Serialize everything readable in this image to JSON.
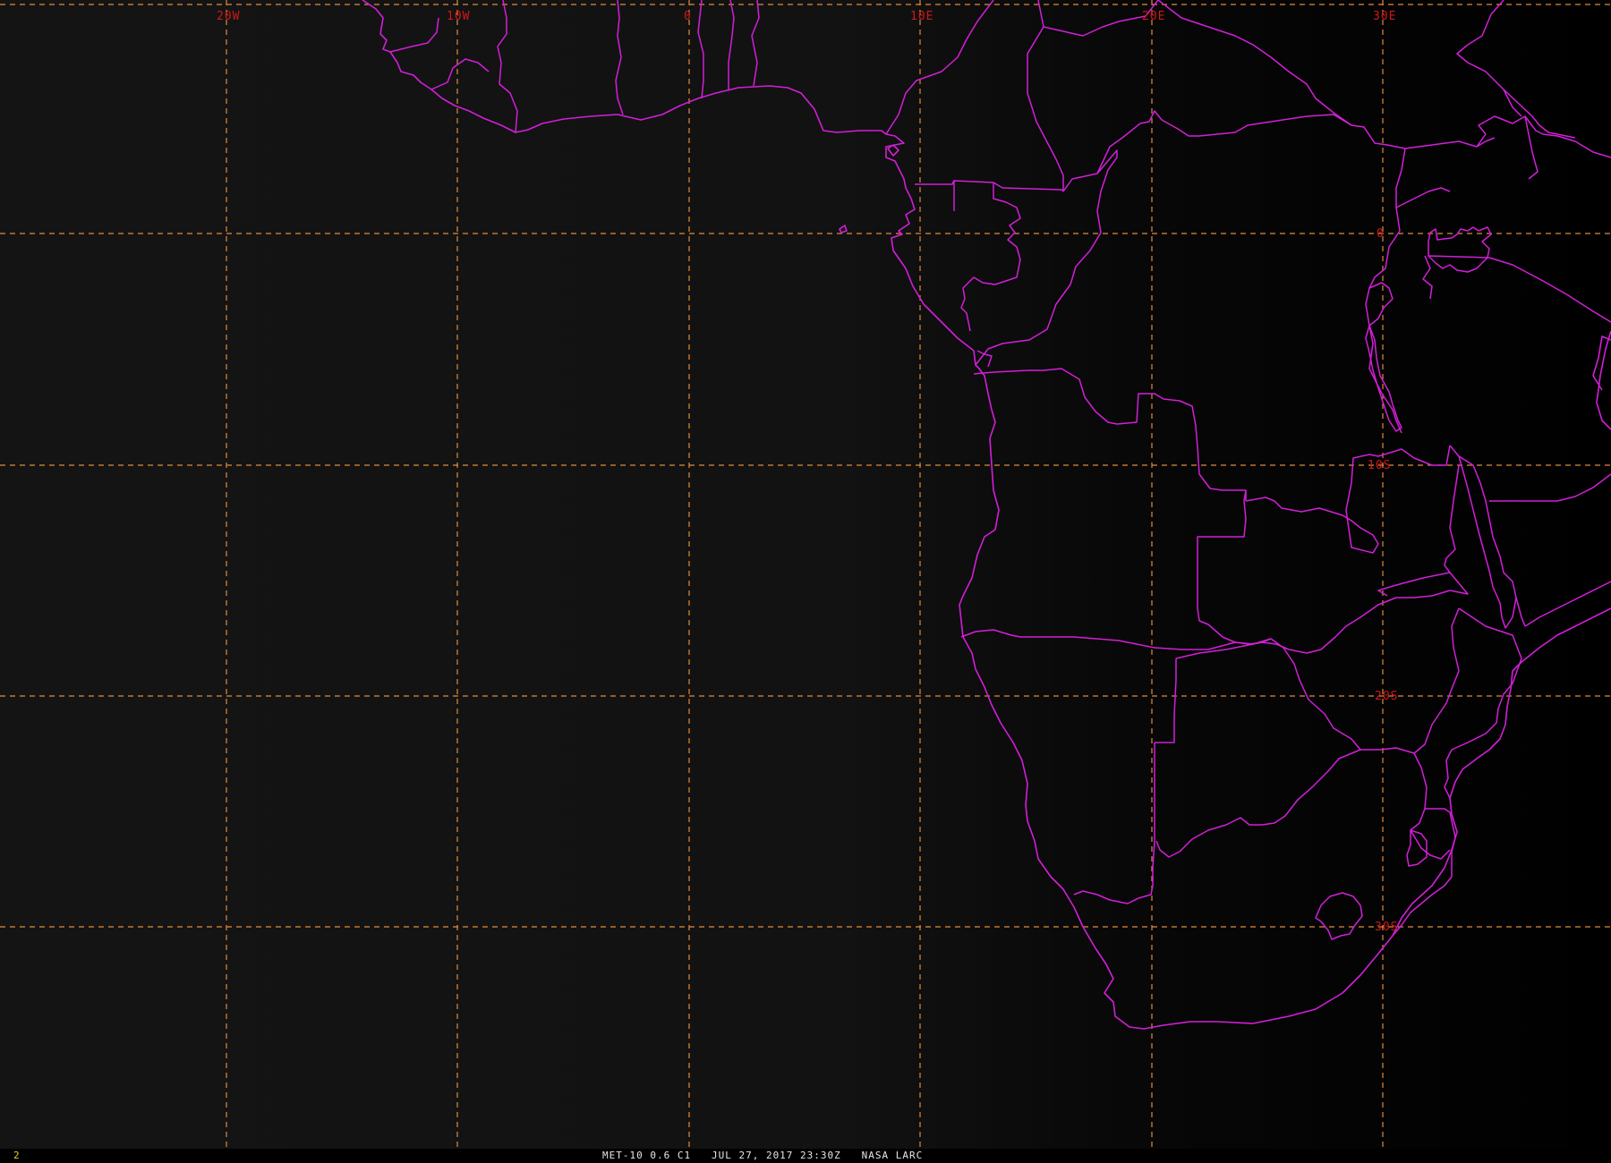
{
  "image": {
    "caption": "MET-10 0.6 C1   JUL 27, 2017 23:30Z   NASA LARC",
    "frame_number": "2"
  },
  "grid": {
    "longitude_labels": [
      {
        "text": "20W",
        "lon": -20
      },
      {
        "text": "10W",
        "lon": -10
      },
      {
        "text": "0",
        "lon": 0
      },
      {
        "text": "10E",
        "lon": 10
      },
      {
        "text": "20E",
        "lon": 20
      },
      {
        "text": "30E",
        "lon": 30
      }
    ],
    "latitude_labels": [
      {
        "text": "0",
        "lat": 0
      },
      {
        "text": "10S",
        "lat": -10
      },
      {
        "text": "20S",
        "lat": -20
      },
      {
        "text": "30S",
        "lat": -30
      }
    ]
  },
  "colors": {
    "background_left": "#121212",
    "background_right": "#000000",
    "grid": "#e08a3c",
    "grid_label": "#d01818",
    "borders": "#d21fd8",
    "frame_number": "#e8d020",
    "caption": "#e6e6e6"
  }
}
